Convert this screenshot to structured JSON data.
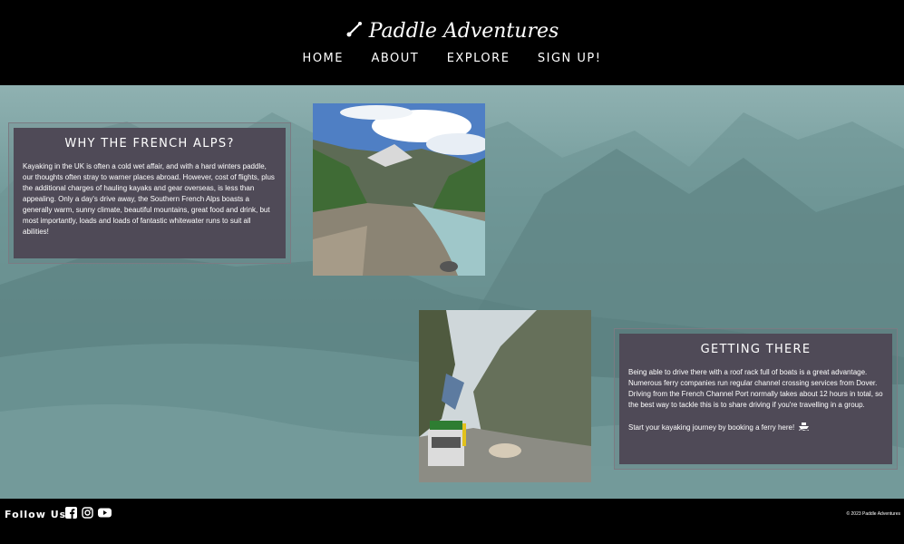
{
  "brand": {
    "name": "Paddle Adventures"
  },
  "nav": {
    "items": [
      "HOME",
      "ABOUT",
      "EXPLORE",
      "SIGN UP!"
    ]
  },
  "section1": {
    "title": "WHY THE FRENCH ALPS?",
    "body": "Kayaking in the UK is often a cold wet affair, and with a hard winters paddle, our thoughts often stray to warner places abroad. However, cost of flights, plus the additional charges of hauling kayaks and gear overseas, is less than appealing. Only a day's drive away, the Southern French Alps boasts a generally warm, sunny climate, beautiful mountains, great food and drink, but most importantly, loads and loads of fantastic whitewater runs to suit all abilities!"
  },
  "section2": {
    "title": "GETTING THERE",
    "body": "Being able to drive there with a roof rack full of boats is a great advantage. Numerous ferry companies run regular channel crossing services from Dover. Driving from the French Channel Port normally takes about 12 hours in total, so the best way to tackle this is to share driving if you're travelling in a group.",
    "cta": "Start your kayaking journey by booking a ferry here!"
  },
  "footer": {
    "follow_label": "Follow Us!",
    "social_icons": [
      "facebook-icon",
      "instagram-icon",
      "youtube-icon"
    ],
    "copyright": "© 2023 Paddle Adventures"
  },
  "colors": {
    "header_bg": "#000000",
    "box_bg": "#4f4a57",
    "hero_tint": "#6f9898"
  }
}
